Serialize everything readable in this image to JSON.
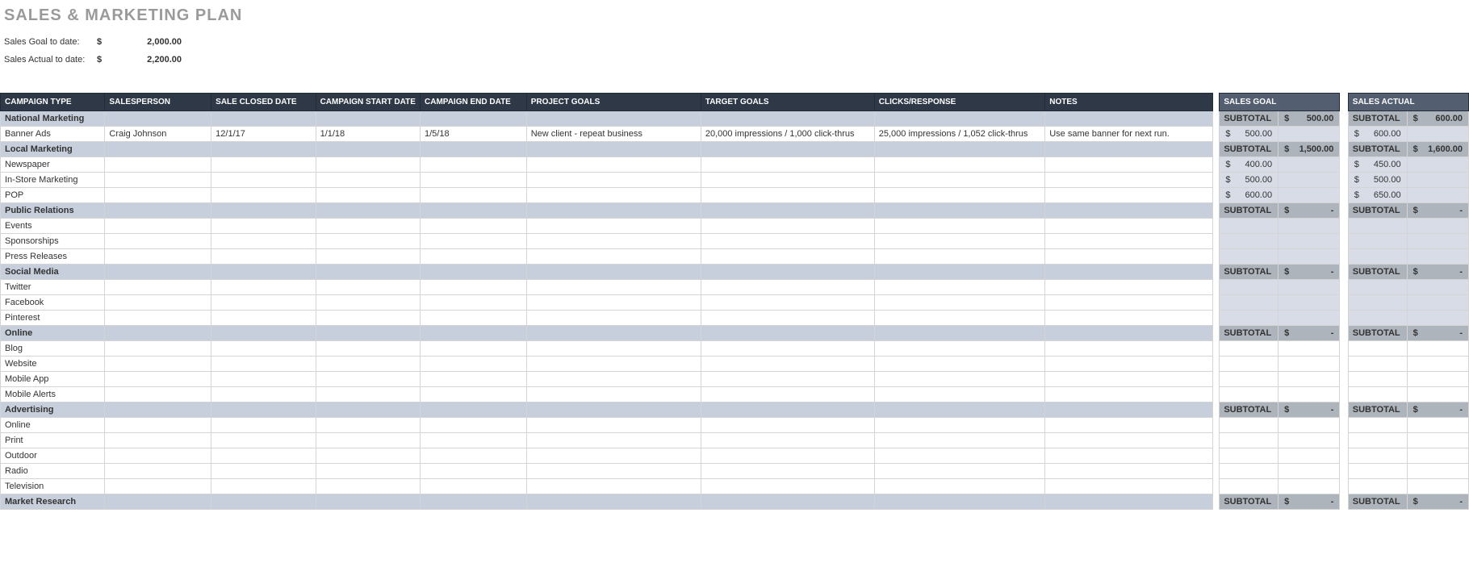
{
  "title": "SALES & MARKETING PLAN",
  "meta": {
    "goal_label": "Sales Goal to date:",
    "goal_currency": "$",
    "goal_value": "2,000.00",
    "actual_label": "Sales Actual to date:",
    "actual_currency": "$",
    "actual_value": "2,200.00"
  },
  "headers": {
    "campaign_type": "CAMPAIGN TYPE",
    "salesperson": "SALESPERSON",
    "sale_closed": "SALE CLOSED DATE",
    "start": "CAMPAIGN START DATE",
    "end": "CAMPAIGN END DATE",
    "project_goals": "PROJECT GOALS",
    "target_goals": "TARGET GOALS",
    "clicks": "CLICKS/RESPONSE",
    "notes": "NOTES",
    "sales_goal": "SALES GOAL",
    "sales_actual": "SALES ACTUAL"
  },
  "subtotal_label": "SUBTOTAL",
  "currency": "$",
  "sections": [
    {
      "name": "National Marketing",
      "goal": "500.00",
      "actual": "600.00",
      "rows": [
        {
          "type": "Banner Ads",
          "person": "Craig Johnson",
          "closed": "12/1/17",
          "start": "1/1/18",
          "end": "1/5/18",
          "project_goals": "New client - repeat business",
          "target_goals": "20,000 impressions / 1,000 click-thrus",
          "clicks": "25,000 impressions / 1,052 click-thrus",
          "notes": "Use same banner for next run.",
          "goal": "500.00",
          "actual": "600.00"
        }
      ]
    },
    {
      "name": "Local Marketing",
      "goal": "1,500.00",
      "actual": "1,600.00",
      "rows": [
        {
          "type": "Newspaper",
          "goal": "400.00",
          "actual": "450.00"
        },
        {
          "type": "In-Store Marketing",
          "goal": "500.00",
          "actual": "500.00"
        },
        {
          "type": "POP",
          "goal": "600.00",
          "actual": "650.00"
        }
      ]
    },
    {
      "name": "Public Relations",
      "goal": "-",
      "actual": "-",
      "rows": [
        {
          "type": "Events"
        },
        {
          "type": "Sponsorships"
        },
        {
          "type": "Press Releases"
        }
      ]
    },
    {
      "name": "Social Media",
      "goal": "-",
      "actual": "-",
      "rows": [
        {
          "type": "Twitter"
        },
        {
          "type": "Facebook"
        },
        {
          "type": "Pinterest"
        }
      ]
    },
    {
      "name": "Online",
      "goal": "-",
      "actual": "-",
      "empty_money": true,
      "rows": [
        {
          "type": "Blog"
        },
        {
          "type": "Website"
        },
        {
          "type": "Mobile App"
        },
        {
          "type": "Mobile Alerts"
        }
      ]
    },
    {
      "name": "Advertising",
      "goal": "-",
      "actual": "-",
      "empty_money": true,
      "rows": [
        {
          "type": "Online"
        },
        {
          "type": "Print"
        },
        {
          "type": "Outdoor"
        },
        {
          "type": "Radio"
        },
        {
          "type": "Television"
        }
      ]
    },
    {
      "name": "Market Research",
      "goal": "-",
      "actual": "-",
      "rows": []
    }
  ]
}
